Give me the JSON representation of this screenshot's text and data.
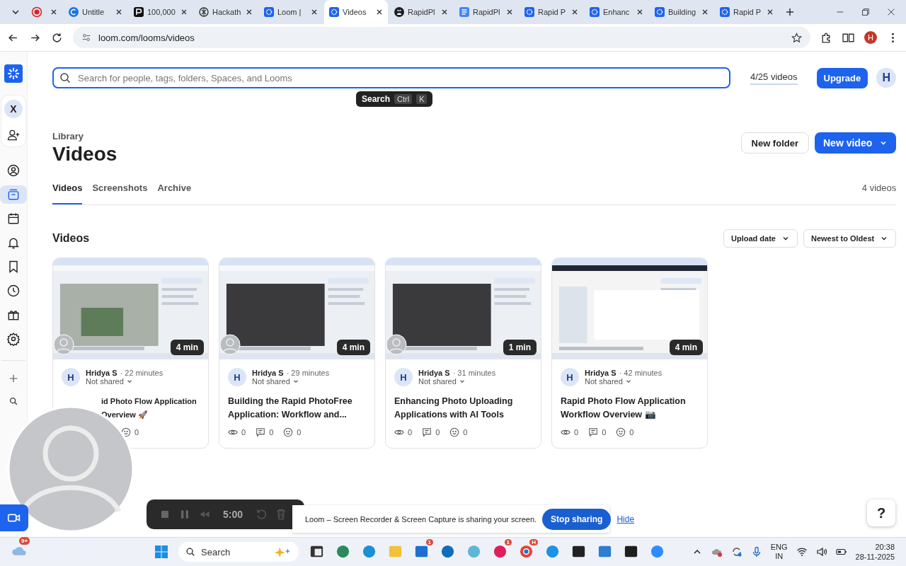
{
  "browser": {
    "tabs": [
      {
        "kind": "record",
        "selected": false
      },
      {
        "kind": "circle",
        "title": "Untitle",
        "selected": false
      },
      {
        "kind": "dark",
        "title": "100,000",
        "selected": false
      },
      {
        "kind": "knot",
        "title": "Hackath",
        "selected": false
      },
      {
        "kind": "loom",
        "title": "Loom |",
        "selected": false
      },
      {
        "kind": "loom",
        "title": "Videos",
        "selected": true
      },
      {
        "kind": "github",
        "title": "RapidPl",
        "selected": false
      },
      {
        "kind": "docs",
        "title": "RapidPl",
        "selected": false
      },
      {
        "kind": "loom",
        "title": "Rapid P",
        "selected": false
      },
      {
        "kind": "loom",
        "title": "Enhanc",
        "selected": false
      },
      {
        "kind": "loom",
        "title": "Building",
        "selected": false
      },
      {
        "kind": "loom",
        "title": "Rapid P",
        "selected": false
      }
    ],
    "url": "loom.com/looms/videos",
    "profile": "H"
  },
  "sidebar": {
    "workspace": "X",
    "items": [
      {
        "kind": "person",
        "selected": false
      },
      {
        "kind": "library",
        "selected": true
      },
      {
        "kind": "calendar",
        "selected": false
      },
      {
        "kind": "bell",
        "selected": false
      },
      {
        "kind": "bookmark",
        "selected": false
      },
      {
        "kind": "clock",
        "selected": false
      },
      {
        "kind": "gift",
        "selected": false
      },
      {
        "kind": "gear",
        "selected": false
      }
    ]
  },
  "topbar": {
    "search_placeholder": "Search for people, tags, folders, Spaces, and Looms",
    "tooltip": {
      "label": "Search",
      "keys": [
        "Ctrl",
        "K"
      ]
    },
    "quota": "4/25 videos",
    "upgrade": "Upgrade",
    "avatar": "H"
  },
  "header": {
    "breadcrumb": "Library",
    "title": "Videos",
    "buttons": [
      "New folder",
      "New video"
    ]
  },
  "tabs": [
    {
      "label": "Videos",
      "selected": true
    },
    {
      "label": "Screenshots",
      "selected": false
    },
    {
      "label": "Archive",
      "selected": false
    }
  ],
  "count": "4 videos",
  "section": {
    "title": "Videos",
    "sort": [
      "Upload date",
      "Newest to Oldest"
    ]
  },
  "cards": [
    {
      "kind": "covered",
      "duration": "4 min",
      "avatar": "H",
      "author": "Hridya S",
      "time": "· 22 minutes",
      "sharing": "Not shared",
      "title": "id Photo Flow Application Overview 🚀",
      "stats": [
        {
          "kind": "reactions",
          "count": "0"
        }
      ]
    },
    {
      "kind": "plain",
      "duration": "4 min",
      "avatar": "H",
      "author": "Hridya S",
      "time": "· 29 minutes",
      "sharing": "Not shared",
      "title": "Building the Rapid PhotoFree Application: Workflow and...",
      "stats": [
        {
          "kind": "views",
          "count": "0"
        },
        {
          "kind": "comments",
          "count": "0"
        },
        {
          "kind": "reactions",
          "count": "0"
        }
      ]
    },
    {
      "kind": "plain",
      "duration": "1 min",
      "avatar": "H",
      "author": "Hridya S",
      "time": "· 31 minutes",
      "sharing": "Not shared",
      "title": "Enhancing Photo Uploading Applications with AI Tools",
      "stats": [
        {
          "kind": "views",
          "count": "0"
        },
        {
          "kind": "comments",
          "count": "0"
        },
        {
          "kind": "reactions",
          "count": "0"
        }
      ]
    },
    {
      "kind": "plain",
      "duration": "4 min",
      "avatar": "H",
      "author": "Hridya S",
      "time": "· 42 minutes",
      "sharing": "Not shared",
      "title": "Rapid Photo Flow Application Workflow Overview 📷",
      "stats": [
        {
          "kind": "views",
          "count": "0"
        },
        {
          "kind": "comments",
          "count": "0"
        },
        {
          "kind": "reactions",
          "count": "0"
        }
      ]
    }
  ],
  "recorder": {
    "timer": "5:00"
  },
  "sharing_bar": {
    "message": "Loom – Screen Recorder & Screen Capture is sharing your screen.",
    "stop": "Stop sharing",
    "hide": "Hide"
  },
  "help": "?",
  "taskbar": {
    "weather_badge": "9+",
    "search": "Search",
    "apps": [
      {
        "kind": "taskview"
      },
      {
        "kind": "edge-dev"
      },
      {
        "kind": "edge"
      },
      {
        "kind": "folder"
      },
      {
        "kind": "store",
        "badge": "1"
      },
      {
        "kind": "outlook"
      },
      {
        "kind": "orb"
      },
      {
        "kind": "slack",
        "badge": "1"
      },
      {
        "kind": "chrome",
        "badge": "H"
      },
      {
        "kind": "docker"
      },
      {
        "kind": "cube"
      },
      {
        "kind": "notepad"
      },
      {
        "kind": "figma"
      },
      {
        "kind": "zoom"
      }
    ],
    "language": [
      "ENG",
      "IN"
    ],
    "time": "20:38",
    "date": "28-11-2025"
  }
}
